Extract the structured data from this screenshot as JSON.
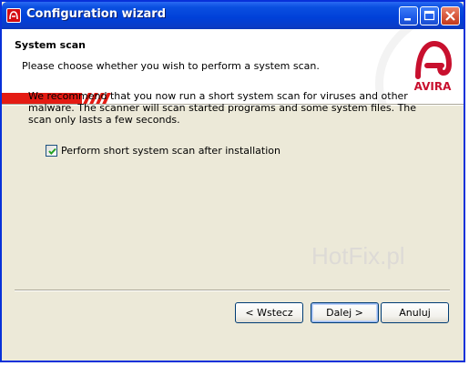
{
  "window": {
    "title": "Configuration wizard",
    "titlebar_color": "#0a4fe0",
    "icon": "avira-umbrella-icon"
  },
  "titlebar_buttons": [
    "minimize-icon",
    "maximize-icon",
    "close-icon"
  ],
  "header": {
    "title": "System scan",
    "subtitle": "Please choose whether you wish to perform a system scan.",
    "logo_text": "AVIRA",
    "brand_color": "#e41b13"
  },
  "body": {
    "description": "We recommend that you now run a short system scan for viruses and other malware. The scanner will scan started programs and some system files. The scan only lasts a few seconds.",
    "checkbox_label": "Perform short system scan after installation",
    "checkbox_checked": true
  },
  "watermark": "HotFix.pl",
  "buttons": {
    "back": "< Wstecz",
    "next": "Dalej >",
    "cancel": "Anuluj"
  }
}
